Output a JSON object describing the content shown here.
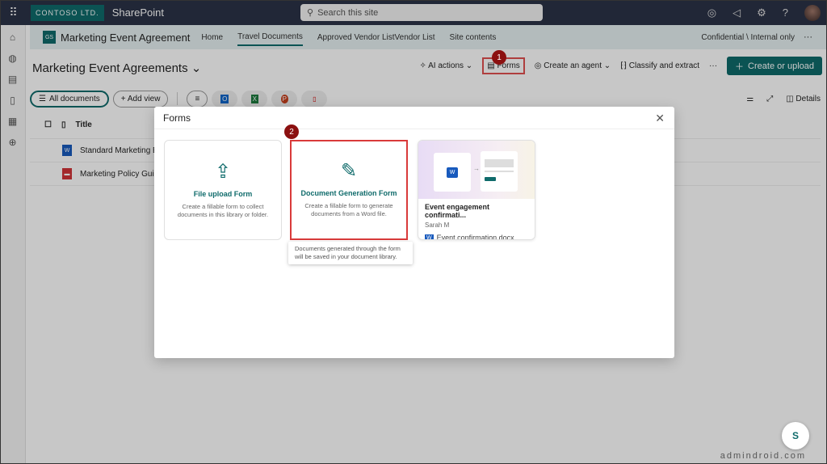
{
  "topbar": {
    "brand": "CONTOSO LTD.",
    "app": "SharePoint",
    "search_placeholder": "Search this site"
  },
  "site": {
    "badge": "GS",
    "name": "Marketing Event Agreement",
    "nav": [
      "Home",
      "Travel Documents",
      "Approved Vendor ListVendor List",
      "Site contents"
    ],
    "active_nav": "Travel Documents",
    "sensitivity": "Confidential \\ Internal only",
    "more": "···"
  },
  "command": {
    "library_title": "Marketing Event Agreements",
    "ai_actions": "AI actions",
    "forms": "Forms",
    "create_agent": "Create an agent",
    "classify": "Classify and extract",
    "more": "···",
    "create_upload": "Create or upload"
  },
  "views": {
    "all_documents": "All documents",
    "add_view": "+ Add view",
    "details": "Details"
  },
  "list": {
    "column_title": "Title",
    "rows": [
      {
        "title": "Standard Marketing Ev",
        "type": "word"
      },
      {
        "title": "Marketing Policy Guide",
        "type": "pdf"
      }
    ]
  },
  "modal": {
    "title": "Forms",
    "cards": [
      {
        "title": "File upload Form",
        "description": "Create a fillable form to collect documents in this library or folder."
      },
      {
        "title": "Document Generation Form",
        "description": "Create a fillable form to generate documents from a Word file."
      }
    ],
    "tooltip": "Documents generated through the form will be saved in your document library.",
    "template": {
      "title": "Event engagement confirmati...",
      "author": "Sarah M",
      "file": "Event confirmation.docx"
    }
  },
  "annotations": {
    "step1": "1",
    "step2": "2"
  },
  "watermark": "admindroid.com",
  "colors": {
    "accent": "#0f6b6b",
    "topbar": "#2b3347",
    "highlight": "#d93a3a",
    "badge": "#8b1010"
  }
}
